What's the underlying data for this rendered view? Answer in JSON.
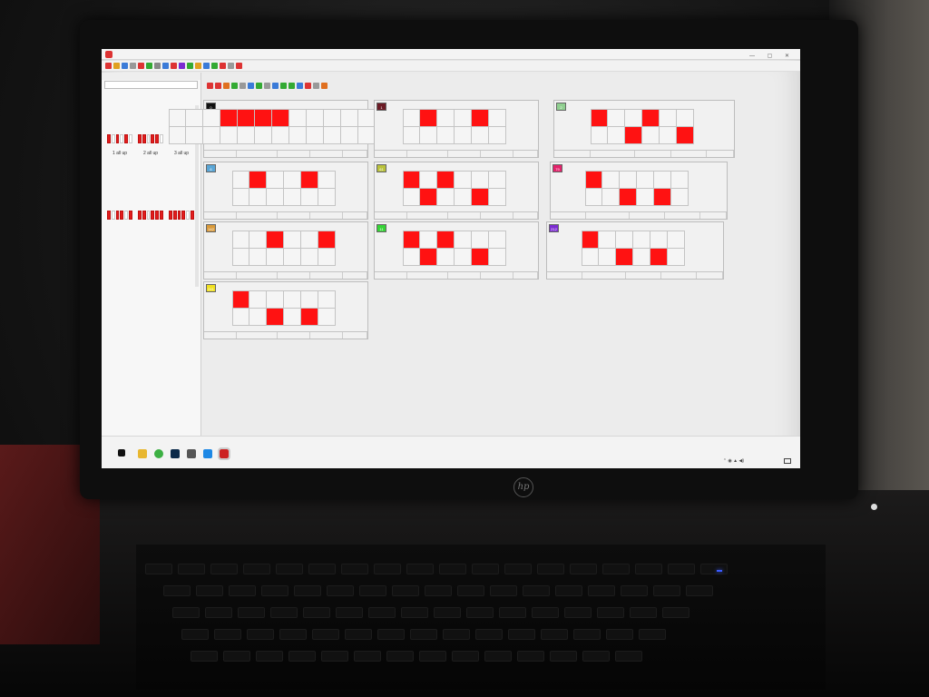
{
  "screen": {
    "title_placeholder": "",
    "win_buttons": "— ▢ ✕"
  },
  "left_panel": {
    "title": "",
    "path": "",
    "rows": [
      "",
      ""
    ],
    "thumbnails": [
      {
        "label": "1 all up",
        "cells": [
          1,
          0,
          1,
          0,
          1,
          0
        ]
      },
      {
        "label": "2 all up",
        "cells": [
          1,
          1,
          0,
          1,
          1,
          0
        ]
      },
      {
        "label": "3 all up",
        "cells": [
          1,
          1,
          1,
          0,
          1,
          1
        ]
      },
      {
        "label": "",
        "cells": [
          1,
          0,
          1,
          1,
          0,
          1
        ]
      },
      {
        "label": "",
        "cells": [
          1,
          1,
          0,
          1,
          1,
          1
        ]
      },
      {
        "label": "",
        "cells": [
          1,
          1,
          1,
          1,
          0,
          1
        ]
      }
    ]
  },
  "doc_menu": "",
  "tiles": [
    {
      "id": "0",
      "tag_color": "#111111",
      "cols": 6,
      "cells": [
        [
          0,
          0,
          0,
          1,
          1,
          1,
          1,
          0,
          0,
          0,
          0,
          0,
          0
        ],
        [
          0,
          0,
          0,
          0,
          0,
          0,
          0,
          0,
          0,
          0,
          0,
          0,
          0
        ]
      ],
      "status": [
        "",
        "",
        "",
        "",
        ""
      ]
    },
    {
      "id": "1",
      "tag_color": "#6b1a24",
      "cols": 6,
      "cells": [
        [
          0,
          1,
          0,
          0,
          1,
          0
        ],
        [
          0,
          0,
          0,
          0,
          0,
          0
        ]
      ],
      "status": [
        "",
        "",
        "",
        "",
        ""
      ]
    },
    {
      "id": "2",
      "tag_color": "#8fcf8f",
      "cols": 6,
      "cells": [
        [
          1,
          0,
          0,
          1,
          0,
          0
        ],
        [
          0,
          0,
          1,
          0,
          0,
          1
        ]
      ],
      "status": [
        "",
        "",
        "",
        "",
        ""
      ]
    },
    {
      "id": "6",
      "tag_color": "#5aa6d6",
      "cols": 6,
      "cells": [
        [
          0,
          1,
          0,
          0,
          1,
          0
        ],
        [
          0,
          0,
          0,
          0,
          0,
          0
        ]
      ],
      "status": [
        "",
        "",
        "",
        "",
        ""
      ]
    },
    {
      "id": "61",
      "tag_color": "#b9c23a",
      "cols": 6,
      "cells": [
        [
          1,
          0,
          1,
          0,
          0,
          0
        ],
        [
          0,
          1,
          0,
          0,
          1,
          0
        ]
      ],
      "status": [
        "",
        "",
        "",
        "",
        ""
      ]
    },
    {
      "id": "79",
      "tag_color": "#e3226b",
      "cols": 6,
      "cells": [
        [
          1,
          0,
          0,
          0,
          0,
          0
        ],
        [
          0,
          0,
          1,
          0,
          1,
          0
        ]
      ],
      "status": [
        "",
        "",
        "",
        "",
        ""
      ]
    },
    {
      "id": "142",
      "tag_color": "#d99a3a",
      "cols": 6,
      "cells": [
        [
          0,
          0,
          1,
          0,
          0,
          1
        ],
        [
          0,
          0,
          0,
          0,
          0,
          0
        ]
      ],
      "status": [
        "",
        "",
        "",
        "",
        ""
      ]
    },
    {
      "id": "11",
      "tag_color": "#35d435",
      "cols": 6,
      "cells": [
        [
          1,
          0,
          1,
          0,
          0,
          0
        ],
        [
          0,
          1,
          0,
          0,
          1,
          0
        ]
      ],
      "status": [
        "",
        "",
        "",
        "",
        ""
      ]
    },
    {
      "id": "212",
      "tag_color": "#7b2bd1",
      "cols": 6,
      "cells": [
        [
          1,
          0,
          0,
          0,
          0,
          0
        ],
        [
          0,
          0,
          1,
          0,
          1,
          0
        ]
      ],
      "status": [
        "",
        "",
        "",
        "",
        ""
      ]
    },
    {
      "id": "241",
      "tag_color": "#f0e020",
      "cols": 6,
      "cells": [
        [
          1,
          0,
          0,
          0,
          0,
          0
        ],
        [
          0,
          0,
          1,
          0,
          1,
          0
        ]
      ],
      "status": [
        "",
        "",
        "",
        "",
        ""
      ]
    }
  ],
  "taskbar": {
    "caption": "",
    "time": "",
    "date": ""
  }
}
